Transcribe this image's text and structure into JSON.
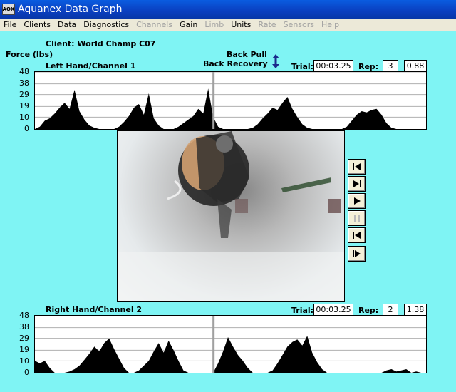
{
  "window": {
    "title": "Aquanex Data Graph",
    "icon_label": "AQX"
  },
  "menu": [
    {
      "label": "File",
      "enabled": true
    },
    {
      "label": "Clients",
      "enabled": true
    },
    {
      "label": "Data",
      "enabled": true
    },
    {
      "label": "Diagnostics",
      "enabled": true
    },
    {
      "label": "Channels",
      "enabled": false
    },
    {
      "label": "Gain",
      "enabled": true
    },
    {
      "label": "Limb",
      "enabled": false
    },
    {
      "label": "Units",
      "enabled": true
    },
    {
      "label": "Rate",
      "enabled": false
    },
    {
      "label": "Sensors",
      "enabled": false
    },
    {
      "label": "Help",
      "enabled": false
    }
  ],
  "client_label": "Client: World Champ C07",
  "force_label": "Force (lbs)",
  "stroke": {
    "phase1": "Back Pull",
    "phase2": "Back Recovery"
  },
  "channel1": {
    "title": "Left Hand/Channel 1",
    "trial_label": "Trial:",
    "trial_value": "00:03.25",
    "rep_label": "Rep:",
    "rep_value": "3",
    "extra_value": "0.88"
  },
  "channel2": {
    "title": "Right Hand/Channel 2",
    "trial_label": "Trial:",
    "trial_value": "00:03.25",
    "rep_label": "Rep:",
    "rep_value": "2",
    "extra_value": "1.38"
  },
  "y_ticks": [
    "48",
    "38",
    "29",
    "19",
    "10",
    "0"
  ],
  "colors": {
    "background": "#7ff4f4",
    "trace": "#000000",
    "cursor": "#a0a0a0"
  },
  "chart_data": [
    {
      "type": "area",
      "title": "Left Hand/Channel 1",
      "ylabel": "Force (lbs)",
      "ylim": [
        0,
        48
      ],
      "x": [
        0,
        1,
        2,
        3,
        4,
        5,
        6,
        7,
        8,
        9,
        10,
        11,
        12,
        13,
        14,
        15,
        16,
        17,
        18,
        19,
        20,
        21,
        22,
        23,
        24,
        25,
        26,
        27,
        28,
        29,
        30,
        31,
        32,
        33,
        34,
        35,
        36,
        37,
        38,
        39,
        40,
        41,
        42,
        43,
        44,
        45,
        46,
        47,
        48,
        49,
        50,
        51,
        52,
        53,
        54,
        55,
        56,
        57,
        58,
        59,
        60,
        61,
        62,
        63,
        64,
        65,
        66,
        67,
        68,
        69,
        70,
        71,
        72,
        73,
        74,
        75,
        76,
        77,
        78,
        79
      ],
      "values": [
        0,
        2,
        7,
        9,
        13,
        18,
        22,
        17,
        33,
        15,
        8,
        3,
        1,
        0,
        0,
        0,
        0,
        2,
        6,
        11,
        18,
        21,
        12,
        30,
        9,
        3,
        0,
        0,
        0,
        2,
        5,
        8,
        11,
        17,
        13,
        34,
        10,
        2,
        0,
        0,
        0,
        0,
        0,
        0,
        1,
        4,
        9,
        13,
        18,
        16,
        22,
        27,
        17,
        10,
        4,
        1,
        0,
        0,
        0,
        0,
        0,
        0,
        0,
        2,
        7,
        12,
        15,
        14,
        16,
        17,
        12,
        5,
        1,
        0,
        0,
        0,
        0,
        0,
        0,
        0
      ],
      "cursor_index": 36
    },
    {
      "type": "area",
      "title": "Right Hand/Channel 2",
      "ylabel": "Force (lbs)",
      "ylim": [
        0,
        48
      ],
      "x": [
        0,
        1,
        2,
        3,
        4,
        5,
        6,
        7,
        8,
        9,
        10,
        11,
        12,
        13,
        14,
        15,
        16,
        17,
        18,
        19,
        20,
        21,
        22,
        23,
        24,
        25,
        26,
        27,
        28,
        29,
        30,
        31,
        32,
        33,
        34,
        35,
        36,
        37,
        38,
        39,
        40,
        41,
        42,
        43,
        44,
        45,
        46,
        47,
        48,
        49,
        50,
        51,
        52,
        53,
        54,
        55,
        56,
        57,
        58,
        59,
        60,
        61,
        62,
        63,
        64,
        65,
        66,
        67,
        68,
        69,
        70,
        71,
        72,
        73,
        74,
        75,
        76,
        77,
        78,
        79
      ],
      "values": [
        10,
        8,
        10,
        4,
        0,
        0,
        0,
        1,
        3,
        6,
        11,
        16,
        22,
        18,
        25,
        29,
        20,
        12,
        4,
        0,
        0,
        2,
        6,
        10,
        18,
        25,
        17,
        27,
        19,
        10,
        2,
        0,
        0,
        0,
        0,
        0,
        0,
        8,
        18,
        30,
        22,
        15,
        10,
        4,
        0,
        0,
        0,
        0,
        2,
        8,
        15,
        22,
        26,
        28,
        23,
        31,
        17,
        9,
        3,
        0,
        0,
        0,
        0,
        0,
        0,
        0,
        0,
        0,
        0,
        0,
        0,
        2,
        3,
        1,
        2,
        3,
        0,
        1,
        0,
        0
      ],
      "cursor_index": 36
    }
  ]
}
